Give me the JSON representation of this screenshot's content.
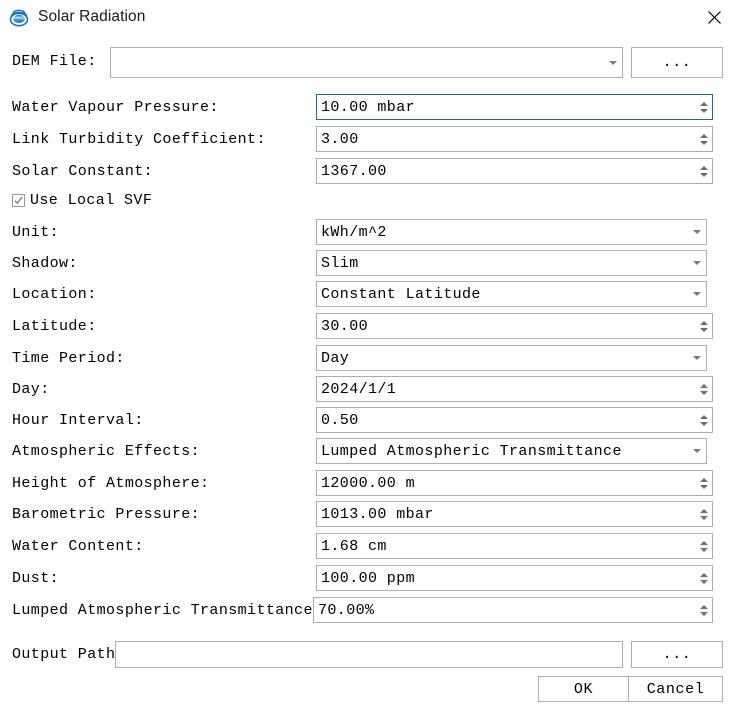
{
  "window": {
    "title": "Solar Radiation",
    "icon": "lidar360-logo-icon",
    "close_label": "✕"
  },
  "form": {
    "dem_file": {
      "label": "DEM File:",
      "value": "",
      "browse_label": "..."
    },
    "rows": [
      {
        "label": "Water Vapour Pressure:",
        "value": "10.00 mbar",
        "kind": "spin",
        "focused": true
      },
      {
        "label": "Link Turbidity Coefficient:",
        "value": "3.00",
        "kind": "spin",
        "focused": false
      },
      {
        "label": "Solar Constant:",
        "value": "1367.00",
        "kind": "spin",
        "focused": false
      },
      {
        "label": "Unit:",
        "value": "kWh/m^2",
        "kind": "combo",
        "focused": false
      },
      {
        "label": "Shadow:",
        "value": "Slim",
        "kind": "combo",
        "focused": false
      },
      {
        "label": "Location:",
        "value": "Constant Latitude",
        "kind": "combo",
        "focused": false
      },
      {
        "label": "Latitude:",
        "value": "30.00",
        "kind": "spin",
        "focused": false
      },
      {
        "label": "Time Period:",
        "value": "Day",
        "kind": "combo",
        "focused": false
      },
      {
        "label": "Day:",
        "value": "2024/1/1",
        "kind": "spin",
        "focused": false
      },
      {
        "label": "Hour Interval:",
        "value": "0.50",
        "kind": "spin",
        "focused": false
      },
      {
        "label": "Atmospheric Effects:",
        "value": "Lumped Atmospheric Transmittance",
        "kind": "combo",
        "focused": false
      },
      {
        "label": "Height of Atmosphere:",
        "value": "12000.00 m",
        "kind": "spin",
        "focused": false
      },
      {
        "label": "Barometric Pressure:",
        "value": "1013.00 mbar",
        "kind": "spin",
        "focused": false
      },
      {
        "label": "Water Content:",
        "value": "1.68 cm",
        "kind": "spin",
        "focused": false
      },
      {
        "label": "Dust:",
        "value": "100.00 ppm",
        "kind": "spin",
        "focused": false
      },
      {
        "label": "Lumped Atmospheric Transmittance:",
        "value": "70.00%",
        "kind": "spin",
        "focused": false
      }
    ],
    "use_local_svf": {
      "label": "Use Local SVF",
      "checked": true
    },
    "output_path": {
      "label": "Output Path:",
      "value": "",
      "browse_label": "..."
    }
  },
  "buttons": {
    "ok": "OK",
    "cancel": "Cancel"
  },
  "colors": {
    "focus_border": "#2c5f9e",
    "field_border": "#adadad",
    "text": "#000000",
    "logo_blue": "#1a6fb5"
  }
}
